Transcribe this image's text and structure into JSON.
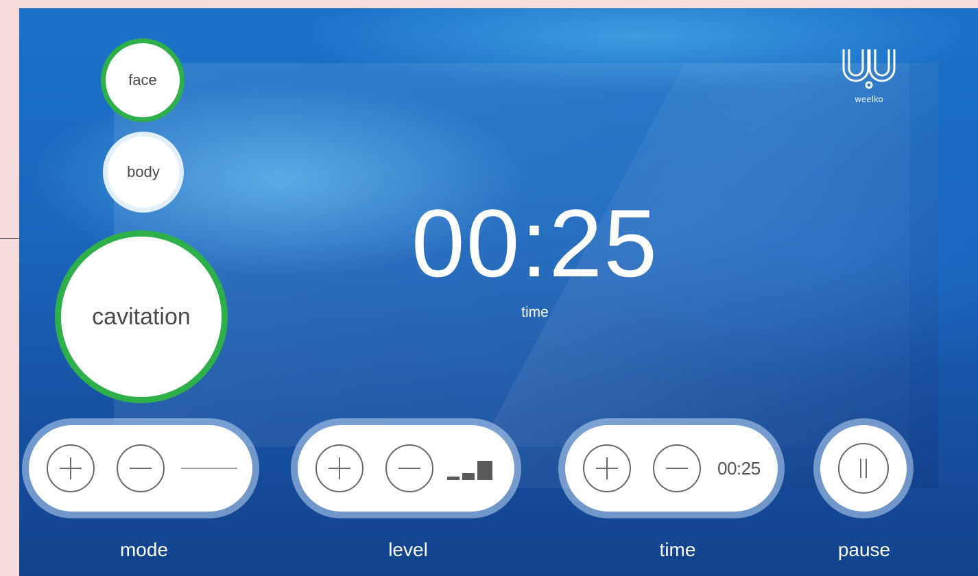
{
  "app": {
    "brand": "weelko",
    "logo_icon": "weelko-logo-icon"
  },
  "zones": {
    "face": "face",
    "body": "body",
    "selected_treatment": "cavitation"
  },
  "timer": {
    "display": "00:25",
    "label": "time"
  },
  "controls": {
    "mode": {
      "label": "mode",
      "increase_icon": "plus-icon",
      "decrease_icon": "minus-icon"
    },
    "level": {
      "label": "level",
      "increase_icon": "plus-icon",
      "decrease_icon": "minus-icon",
      "bars_total": 3,
      "bars_active": 3
    },
    "time": {
      "label": "time",
      "value": "00:25",
      "increase_icon": "plus-icon",
      "decrease_icon": "minus-icon"
    },
    "pause": {
      "label": "pause",
      "icon": "pause-icon"
    }
  },
  "colors": {
    "accent_selected": "#2db04a",
    "screen_blue": "#1a66bd",
    "text_white": "#ffffff"
  }
}
